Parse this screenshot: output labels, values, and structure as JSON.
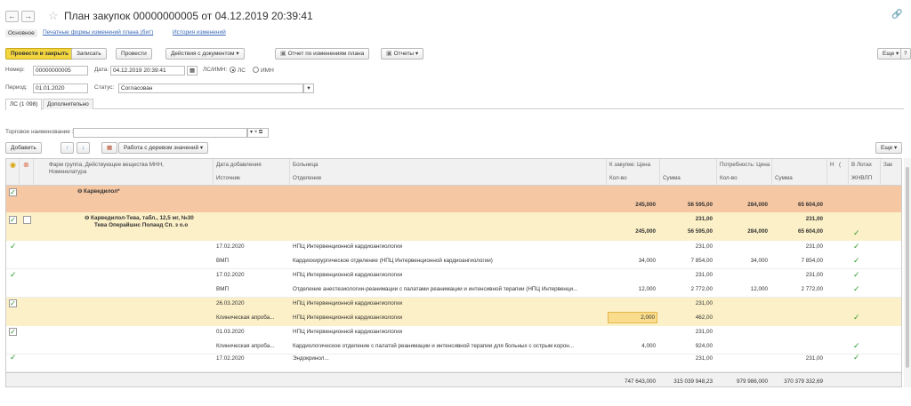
{
  "window": {
    "title": "План закупок 00000000005 от 04.12.2019 20:39:41",
    "back": "←",
    "forward": "→"
  },
  "top_tabs": {
    "main": "Основное",
    "print_forms": "Печатные формы изменений плана (бит)",
    "history": "История изменений"
  },
  "toolbar": {
    "post_close": "Провести и закрыть",
    "save": "Записать",
    "post": "Провести",
    "doc_actions": "Действия с документом",
    "changes_report": "Отчет по изменениям плана",
    "reports": "Отчеты",
    "more": "Еще",
    "help": "?"
  },
  "form": {
    "number_label": "Номер:",
    "number_value": "00000000005",
    "date_label": "Дата:",
    "date_value": "04.12.2019 20:39:41",
    "ls_imn_label": "ЛС/ИМН:",
    "opt_ls": "ЛС",
    "opt_imn": "ИМН",
    "period_label": "Период:",
    "period_value": "01.01.2020",
    "status_label": "Статус:",
    "status_value": "Согласован"
  },
  "subtabs": {
    "ls": "ЛС (1 098)",
    "extra": "Дополнительно"
  },
  "filter": {
    "trade_name_label": "Торговое наименование :"
  },
  "grid_toolbar": {
    "add": "Добавить",
    "up": "↑",
    "down": "↓",
    "tree_actions": "Работа с деревом значений",
    "more": "Еще"
  },
  "columns": {
    "pharm_group": "Фарм группа, Действующее вещества МНН,",
    "nomenclature": "Номенклатура",
    "date_added": "Дата добавления",
    "source": "Источник",
    "hospital": "Больница",
    "department": "Отделение",
    "to_purchase_price": "К закупке: Цена",
    "qty": "Кол-во",
    "sum": "Сумма",
    "need_price": "Потребность: Цена",
    "need_qty": "Кол-во",
    "need_sum": "Сумма",
    "col_h": "Н",
    "col_c": "(",
    "in_lots": "В Лотах",
    "zhnvlp": "ЖНВЛП",
    "zak": "Зак"
  },
  "rows": {
    "group": {
      "name": "Карведилол*",
      "qty": "245,000",
      "sum": "56 595,00",
      "need_qty": "284,000",
      "need_sum": "65 604,00"
    },
    "item": {
      "name1": "Карведилол-Тева, табл., 12,5 мг, №30",
      "name2": "Тева Операйшнс Поланд Сп. з о.о",
      "price": "231,00",
      "need_price": "231,00",
      "qty": "245,000",
      "sum": "56 595,00",
      "need_qty": "284,000",
      "need_sum": "65 604,00"
    },
    "r1": {
      "date": "17.02.2020",
      "hospital": "НПЦ Интервенционной кардиоангиологии",
      "price": "231,00",
      "need_price": "231,00",
      "source": "ВМП",
      "dept": "Кардиохирургическое отделение (НПЦ Интервенционной кардиоангиологии)",
      "qty": "34,000",
      "sum": "7 854,00",
      "need_qty": "34,000",
      "need_sum": "7 854,00"
    },
    "r2": {
      "date": "17.02.2020",
      "hospital": "НПЦ Интервенционной кардиоангиологии",
      "price": "231,00",
      "need_price": "231,00",
      "source": "ВМП",
      "dept": "Отделение анестезиологии-реанимации с палатами реанимации и интенсивной терапии (НПЦ Интервенци...",
      "qty": "12,000",
      "sum": "2 772,00",
      "need_qty": "12,000",
      "need_sum": "2 772,00"
    },
    "r3": {
      "date": "26.03.2020",
      "hospital": "НПЦ Интервенционной кардиоангиологии",
      "price": "231,00",
      "source": "Клиническая апроба...",
      "dept": "НПЦ Интервенционной кардиоангиологии",
      "qty": "2,000",
      "sum": "462,00"
    },
    "r4": {
      "date": "01.03.2020",
      "hospital": "НПЦ Интервенционной кардиоангиологии",
      "price": "231,00",
      "source": "Клиническая апроба...",
      "dept": "Кардиологическое отделение с палатой реанимации и интенсивной терапии для больных с острым корон...",
      "qty": "4,000",
      "sum": "924,00"
    },
    "r5": {
      "date": "17.02.2020",
      "hospital": "Эндокринол...",
      "price": "231,00",
      "need_price": "231,00"
    }
  },
  "totals": {
    "qty": "747 643,000",
    "sum": "315 039 948,23",
    "need_qty": "979 986,000",
    "need_sum": "370 379 332,69"
  }
}
